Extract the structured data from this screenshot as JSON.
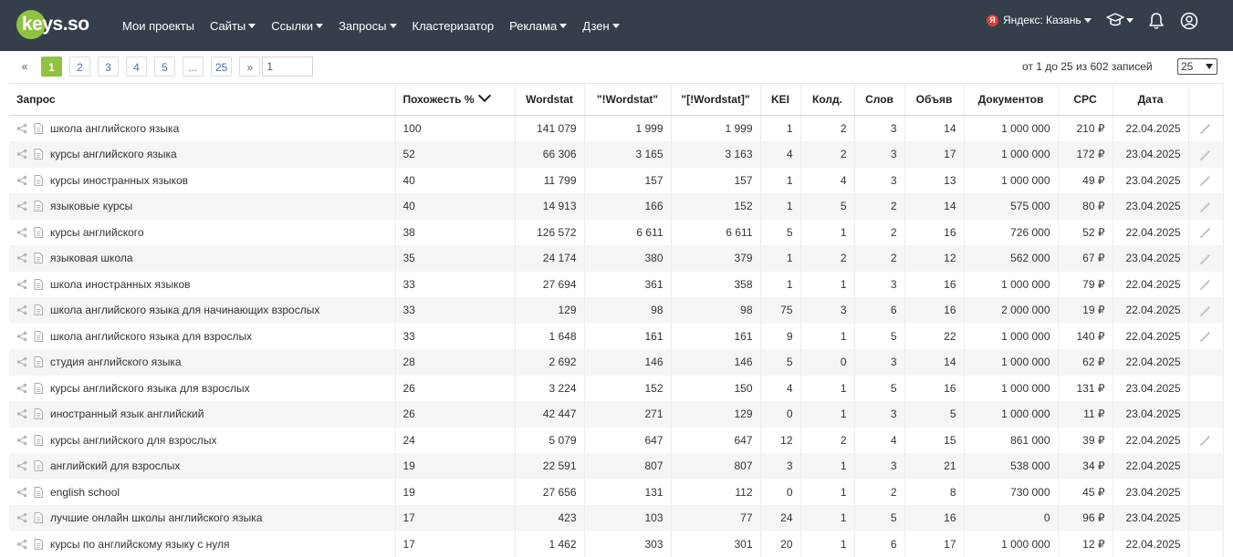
{
  "header": {
    "logo": "keys.so",
    "nav": [
      {
        "label": "Мои проекты",
        "dropdown": false
      },
      {
        "label": "Сайты",
        "dropdown": true
      },
      {
        "label": "Ссылки",
        "dropdown": true
      },
      {
        "label": "Запросы",
        "dropdown": true
      },
      {
        "label": "Кластеризатор",
        "dropdown": false
      },
      {
        "label": "Реклама",
        "dropdown": true
      },
      {
        "label": "Дзен",
        "dropdown": true
      }
    ],
    "region_badge": "Я",
    "region": "Яндекс: Казань"
  },
  "pagination": {
    "prev": "«",
    "pages": [
      "1",
      "2",
      "3",
      "4",
      "5",
      "...",
      "25"
    ],
    "active": "1",
    "next": "»",
    "goto_value": "1",
    "records": "от 1 до 25 из 602 записей",
    "per_page": "25"
  },
  "table": {
    "headers": [
      "Запрос",
      "Похожесть %",
      "Wordstat",
      "\"!Wordstat\"",
      "\"[!Wordstat]\"",
      "KEI",
      "Колд.",
      "Слов",
      "Объяв",
      "Документов",
      "CPC",
      "Дата"
    ],
    "rows": [
      [
        "школа английского языка",
        "100",
        "141 079",
        "1 999",
        "1 999",
        "1",
        "2",
        "3",
        "14",
        "1 000 000",
        "210 ₽",
        "22.04.2025",
        true
      ],
      [
        "курсы английского языка",
        "52",
        "66 306",
        "3 165",
        "3 163",
        "4",
        "2",
        "3",
        "17",
        "1 000 000",
        "172 ₽",
        "23.04.2025",
        true
      ],
      [
        "курсы иностранных языков",
        "40",
        "11 799",
        "157",
        "157",
        "1",
        "4",
        "3",
        "13",
        "1 000 000",
        "49 ₽",
        "23.04.2025",
        true
      ],
      [
        "языковые курсы",
        "40",
        "14 913",
        "166",
        "152",
        "1",
        "5",
        "2",
        "14",
        "575 000",
        "80 ₽",
        "23.04.2025",
        true
      ],
      [
        "курсы английского",
        "38",
        "126 572",
        "6 611",
        "6 611",
        "5",
        "1",
        "2",
        "16",
        "726 000",
        "52 ₽",
        "22.04.2025",
        true
      ],
      [
        "языковая школа",
        "35",
        "24 174",
        "380",
        "379",
        "1",
        "2",
        "2",
        "12",
        "562 000",
        "67 ₽",
        "23.04.2025",
        true
      ],
      [
        "школа иностранных языков",
        "33",
        "27 694",
        "361",
        "358",
        "1",
        "1",
        "3",
        "16",
        "1 000 000",
        "79 ₽",
        "22.04.2025",
        true
      ],
      [
        "школа английского языка для начинающих взрослых",
        "33",
        "129",
        "98",
        "98",
        "75",
        "3",
        "6",
        "16",
        "2 000 000",
        "19 ₽",
        "22.04.2025",
        true
      ],
      [
        "школа английского языка для взрослых",
        "33",
        "1 648",
        "161",
        "161",
        "9",
        "1",
        "5",
        "22",
        "1 000 000",
        "140 ₽",
        "22.04.2025",
        true
      ],
      [
        "студия английского языка",
        "28",
        "2 692",
        "146",
        "146",
        "5",
        "0",
        "3",
        "14",
        "1 000 000",
        "62 ₽",
        "22.04.2025",
        false
      ],
      [
        "курсы английского языка для взрослых",
        "26",
        "3 224",
        "152",
        "150",
        "4",
        "1",
        "5",
        "16",
        "1 000 000",
        "131 ₽",
        "23.04.2025",
        false
      ],
      [
        "иностранный язык английский",
        "26",
        "42 447",
        "271",
        "129",
        "0",
        "1",
        "3",
        "5",
        "1 000 000",
        "11 ₽",
        "23.04.2025",
        false
      ],
      [
        "курсы английского для взрослых",
        "24",
        "5 079",
        "647",
        "647",
        "12",
        "2",
        "4",
        "15",
        "861 000",
        "39 ₽",
        "22.04.2025",
        true
      ],
      [
        "английский для взрослых",
        "19",
        "22 591",
        "807",
        "807",
        "3",
        "1",
        "3",
        "21",
        "538 000",
        "34 ₽",
        "22.04.2025",
        false
      ],
      [
        "english school",
        "19",
        "27 656",
        "131",
        "112",
        "0",
        "1",
        "2",
        "8",
        "730 000",
        "45 ₽",
        "23.04.2025",
        false
      ],
      [
        "лучшие онлайн школы английского языка",
        "17",
        "423",
        "103",
        "77",
        "24",
        "1",
        "5",
        "16",
        "0",
        "96 ₽",
        "23.04.2025",
        false
      ],
      [
        "курсы по английскому языку с нуля",
        "17",
        "1 462",
        "303",
        "301",
        "20",
        "1",
        "6",
        "17",
        "1 000 000",
        "12 ₽",
        "22.04.2025",
        false
      ]
    ]
  }
}
